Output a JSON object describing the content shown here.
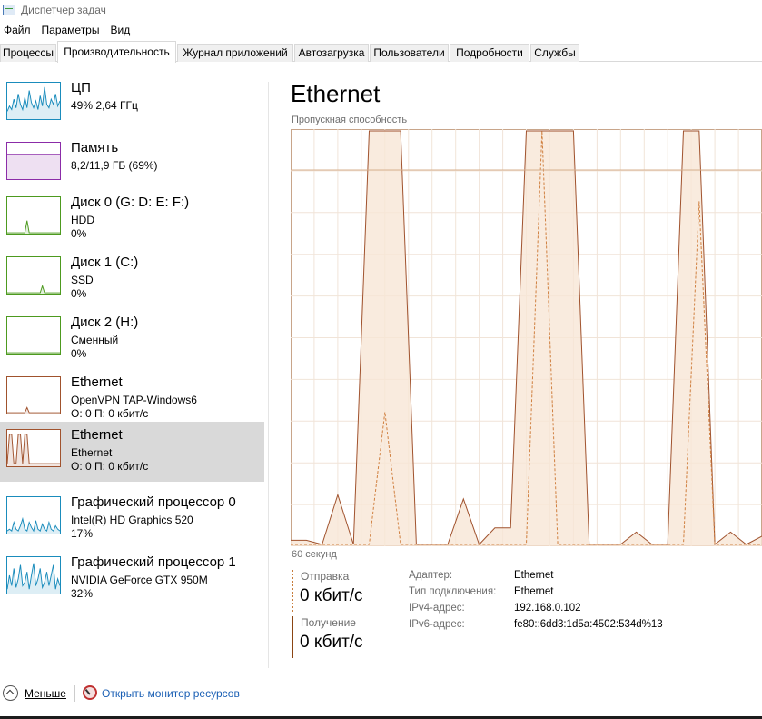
{
  "window": {
    "title": "Диспетчер задач"
  },
  "menu": [
    "Файл",
    "Параметры",
    "Вид"
  ],
  "tabs": [
    "Процессы",
    "Производительность",
    "Журнал приложений",
    "Автозагрузка",
    "Пользователи",
    "Подробности",
    "Службы"
  ],
  "active_tab": "Производительность",
  "sidebar": [
    {
      "title": "ЦП",
      "line1": "49% 2,64 ГГц",
      "line2": "",
      "color": "#1a8cbc",
      "spark": [
        0.2,
        0.35,
        0.25,
        0.55,
        0.3,
        0.7,
        0.4,
        0.25,
        0.6,
        0.3,
        0.8,
        0.45,
        0.3,
        0.5,
        0.25,
        0.65,
        0.35,
        0.9,
        0.4,
        0.3,
        0.55,
        0.4,
        0.7,
        0.35,
        0.5
      ]
    },
    {
      "title": "Память",
      "line1": "8,2/11,9 ГБ (69%)",
      "line2": "",
      "color": "#8b2ca8",
      "spark": [
        0.69,
        0.69,
        0.69,
        0.69,
        0.69,
        0.69,
        0.69,
        0.69,
        0.69,
        0.69
      ]
    },
    {
      "title": "Диск 0 (G: D: E: F:)",
      "line1": "HDD",
      "line2": "0%",
      "color": "#4d9a1f",
      "spark": [
        0,
        0,
        0,
        0,
        0,
        0,
        0,
        0,
        0,
        0.35,
        0,
        0,
        0,
        0,
        0,
        0,
        0,
        0,
        0,
        0,
        0,
        0,
        0,
        0,
        0
      ]
    },
    {
      "title": "Диск 1 (C:)",
      "line1": "SSD",
      "line2": "0%",
      "color": "#4d9a1f",
      "spark": [
        0,
        0,
        0,
        0,
        0,
        0,
        0,
        0,
        0,
        0,
        0,
        0,
        0,
        0,
        0,
        0,
        0.2,
        0,
        0,
        0,
        0,
        0,
        0,
        0,
        0
      ]
    },
    {
      "title": "Диск 2 (H:)",
      "line1": "Сменный",
      "line2": "0%",
      "color": "#4d9a1f",
      "spark": [
        0,
        0,
        0,
        0,
        0,
        0,
        0,
        0,
        0,
        0
      ]
    },
    {
      "title": "Ethernet",
      "line1": "OpenVPN TAP-Windows6",
      "line2": "О: 0 П: 0 кбит/с",
      "color": "#a0522d",
      "spark": [
        0,
        0,
        0,
        0,
        0,
        0,
        0,
        0,
        0,
        0.15,
        0,
        0,
        0,
        0,
        0,
        0,
        0,
        0,
        0,
        0,
        0,
        0,
        0,
        0,
        0
      ]
    },
    {
      "title": "Ethernet",
      "line1": "Ethernet",
      "line2": "О: 0 П: 0 кбит/с",
      "color": "#a0522d",
      "spark": [
        0.05,
        0.9,
        0.9,
        0.05,
        0.05,
        0.9,
        0.9,
        0.05,
        0.9,
        0.9,
        0.05,
        0.05,
        0.05,
        0.05,
        0.05,
        0.05,
        0.05,
        0.05,
        0.05,
        0.05,
        0.05,
        0.05,
        0.05,
        0.05,
        0.05
      ]
    },
    {
      "title": "Графический процессор 0",
      "line1": "Intel(R) HD Graphics 520",
      "line2": "17%",
      "color": "#1a8cbc",
      "spark": [
        0.05,
        0.1,
        0.05,
        0.3,
        0.1,
        0.05,
        0.2,
        0.4,
        0.1,
        0.05,
        0.3,
        0.15,
        0.05,
        0.35,
        0.1,
        0.05,
        0.25,
        0.1,
        0.05,
        0.3,
        0.1,
        0.05,
        0.2,
        0.1,
        0.05
      ]
    },
    {
      "title": "Графический процессор 1",
      "line1": "NVIDIA GeForce GTX 950M",
      "line2": "32%",
      "color": "#1a8cbc",
      "spark": [
        0.1,
        0.5,
        0.2,
        0.7,
        0.15,
        0.4,
        0.8,
        0.2,
        0.3,
        0.6,
        0.1,
        0.5,
        0.85,
        0.2,
        0.4,
        0.7,
        0.15,
        0.3,
        0.6,
        0.2,
        0.5,
        0.8,
        0.1,
        0.4,
        0.2
      ]
    }
  ],
  "selected_index": 6,
  "main": {
    "title": "Ethernet",
    "graph_label": "Пропускная способность",
    "time_label": "60 секунд",
    "send_label": "Отправка",
    "send_value": "0 кбит/с",
    "recv_label": "Получение",
    "recv_value": "0 кбит/с",
    "props": [
      {
        "key": "Адаптер:",
        "value": "Ethernet"
      },
      {
        "key": "Тип подключения:",
        "value": "Ethernet"
      },
      {
        "key": "IPv4-адрес:",
        "value": "192.168.0.102"
      },
      {
        "key": "IPv6-адрес:",
        "value": "fe80::6dd3:1d5a:4502:534d%13"
      }
    ]
  },
  "footer": {
    "less": "Меньше",
    "resmon": "Открыть монитор ресурсов"
  },
  "chart_data": {
    "type": "area",
    "x": [
      0,
      2,
      4,
      6,
      8,
      10,
      12,
      14,
      16,
      18,
      20,
      22,
      24,
      26,
      28,
      30,
      32,
      34,
      36,
      38,
      40,
      42,
      44,
      46,
      48,
      50,
      52,
      54,
      56,
      58,
      60
    ],
    "series": [
      {
        "values": [
          0.01,
          0.01,
          0.0,
          0.12,
          0.0,
          1.0,
          1.0,
          1.0,
          0.0,
          0.0,
          0.0,
          0.11,
          0.0,
          0.04,
          0.04,
          1.0,
          1.0,
          1.0,
          1.0,
          0.0,
          0.0,
          0.0,
          0.03,
          0.0,
          0.0,
          1.0,
          1.0,
          0.0,
          0.03,
          0.0,
          0.02
        ]
      },
      {
        "values": [
          0.0,
          0.0,
          0.0,
          0.0,
          0.0,
          0.0,
          0.32,
          0.0,
          0.0,
          0.0,
          0.0,
          0.0,
          0.0,
          0.0,
          0.0,
          0.0,
          1.0,
          0.0,
          0.0,
          0.0,
          0.0,
          0.0,
          0.0,
          0.0,
          0.0,
          0.0,
          0.83,
          0.0,
          0.0,
          0.0,
          0.0
        ]
      }
    ],
    "colors": [
      "#a0522d",
      "#d08040"
    ],
    "grid": true,
    "xlim": [
      0,
      60
    ]
  }
}
